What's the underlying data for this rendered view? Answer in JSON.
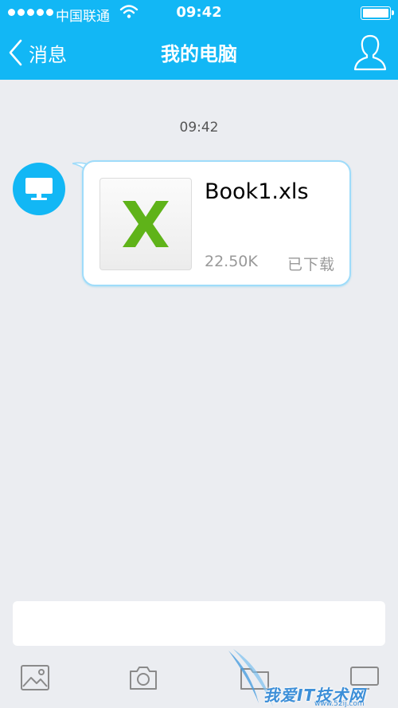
{
  "status_bar": {
    "carrier": "中国联通",
    "time": "09:42"
  },
  "nav": {
    "back_label": "消息",
    "title": "我的电脑"
  },
  "chat": {
    "timestamp": "09:42",
    "message": {
      "file_name": "Book1.xls",
      "file_size": "22.50K",
      "status": "已下载",
      "icon": "excel-file-icon"
    }
  },
  "toolbar": {
    "items": [
      "image-icon",
      "camera-icon",
      "folder-icon",
      "screen-icon"
    ]
  },
  "watermark": {
    "text": "我爱IT技术网",
    "url": "www.52ij.com"
  },
  "colors": {
    "accent": "#12b7f5",
    "background": "#ebedf1",
    "excel_green": "#5fb319"
  }
}
